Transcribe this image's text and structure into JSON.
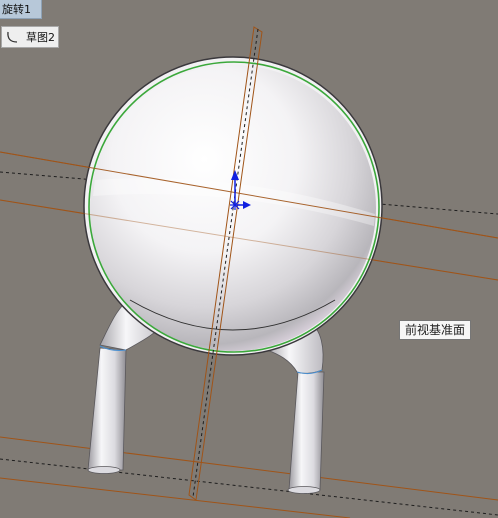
{
  "feature_tree": {
    "revolve_label": "旋转1",
    "sketch_label": "草图2"
  },
  "viewport": {
    "plane_label": "前视基准面"
  },
  "colors": {
    "background": "#807b75",
    "sketch_green": "#3ba83b",
    "plane_orange": "#a05418",
    "axis_blue": "#1020e0"
  }
}
